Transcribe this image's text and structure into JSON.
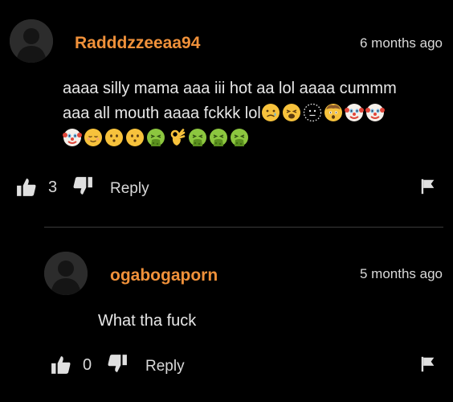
{
  "comments": [
    {
      "username": "Radddzzeeaa94",
      "time": "6 months ago",
      "text_line1": "aaaa silly mama aaa iii hot aa lol aaaa cummm",
      "text_line2": "aaa all mouth aaaa fckkk lol",
      "emojis_line2": [
        "sad-tear-emoji",
        "tired-face-emoji",
        "dotted-face-emoji",
        "exploding-head-emoji",
        "clown-emoji",
        "clown-emoji"
      ],
      "emojis_line3": [
        "clown-emoji",
        "relieved-emoji",
        "hushed-face-emoji",
        "hushed-face-emoji",
        "vomiting-emoji",
        "ok-hand-emoji",
        "vomiting-emoji",
        "vomiting-emoji",
        "vomiting-emoji"
      ],
      "likes": "3",
      "reply_label": "Reply"
    },
    {
      "username": "ogabogaporn",
      "time": "5 months ago",
      "text_line1": "What tha fuck",
      "likes": "0",
      "reply_label": "Reply"
    }
  ],
  "colors": {
    "username": "#f0913a",
    "background": "#000000",
    "text": "#e8e8e8"
  }
}
